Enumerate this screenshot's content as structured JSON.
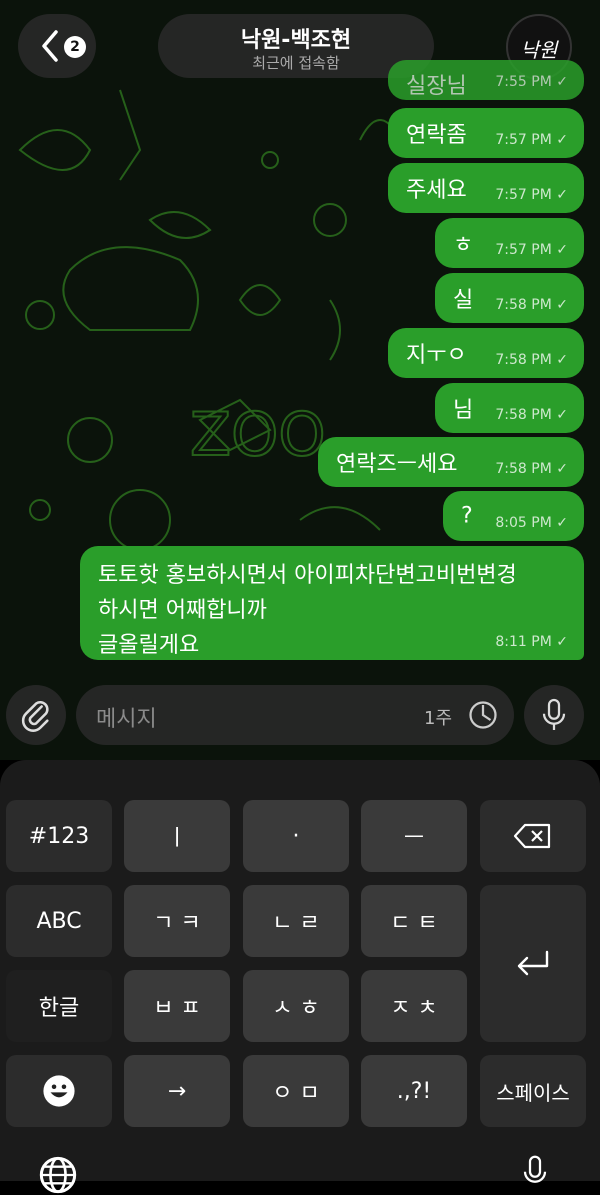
{
  "header": {
    "back_badge": "2",
    "title": "낙원-백조현",
    "subtitle": "최근에 접속함",
    "avatar_text": "낙원"
  },
  "messages": [
    {
      "text": "실장님",
      "time": "7:55 PM"
    },
    {
      "text": "연락좀",
      "time": "7:57 PM"
    },
    {
      "text": "주세요",
      "time": "7:57 PM"
    },
    {
      "text": "ㅎ",
      "time": "7:57 PM"
    },
    {
      "text": "실",
      "time": "7:58 PM"
    },
    {
      "text": "지ㅜㅇ",
      "time": "7:58 PM"
    },
    {
      "text": "님",
      "time": "7:58 PM"
    },
    {
      "text": "연락즈ㅡ세요",
      "time": "7:58 PM"
    },
    {
      "text": "?",
      "time": "8:05 PM"
    },
    {
      "text": "토토핫 홍보하시면서 아이피차단변고비번변경하시면 어쩌합니까 글올릴게요",
      "line1": "토토핫 홍보하시면서 아이피차단변고비번변경",
      "line2": "하시면 어째합니까",
      "line3": "글올릴게요",
      "time": "8:11 PM"
    }
  ],
  "composer": {
    "placeholder": "메시지",
    "timer": "1주"
  },
  "keyboard": {
    "rows": [
      [
        "#123",
        "ㅣ",
        "·",
        "ㅡ",
        "⌫"
      ],
      [
        "ABC",
        "ㄱ ㅋ",
        "ㄴ ㄹ",
        "ㄷ ㅌ",
        "↵"
      ],
      [
        "한글",
        "ㅂ ㅍ",
        "ㅅ ㅎ",
        "ㅈ ㅊ"
      ],
      [
        "emoji",
        "→",
        "ㅇ ㅁ",
        ".,?!",
        "스페이스"
      ]
    ],
    "colors": {
      "key": "#3a3a3a",
      "background": "#1b1b1b"
    }
  },
  "colors": {
    "bubble": "#2a9e2a",
    "chat_bg": "#0b130b"
  }
}
